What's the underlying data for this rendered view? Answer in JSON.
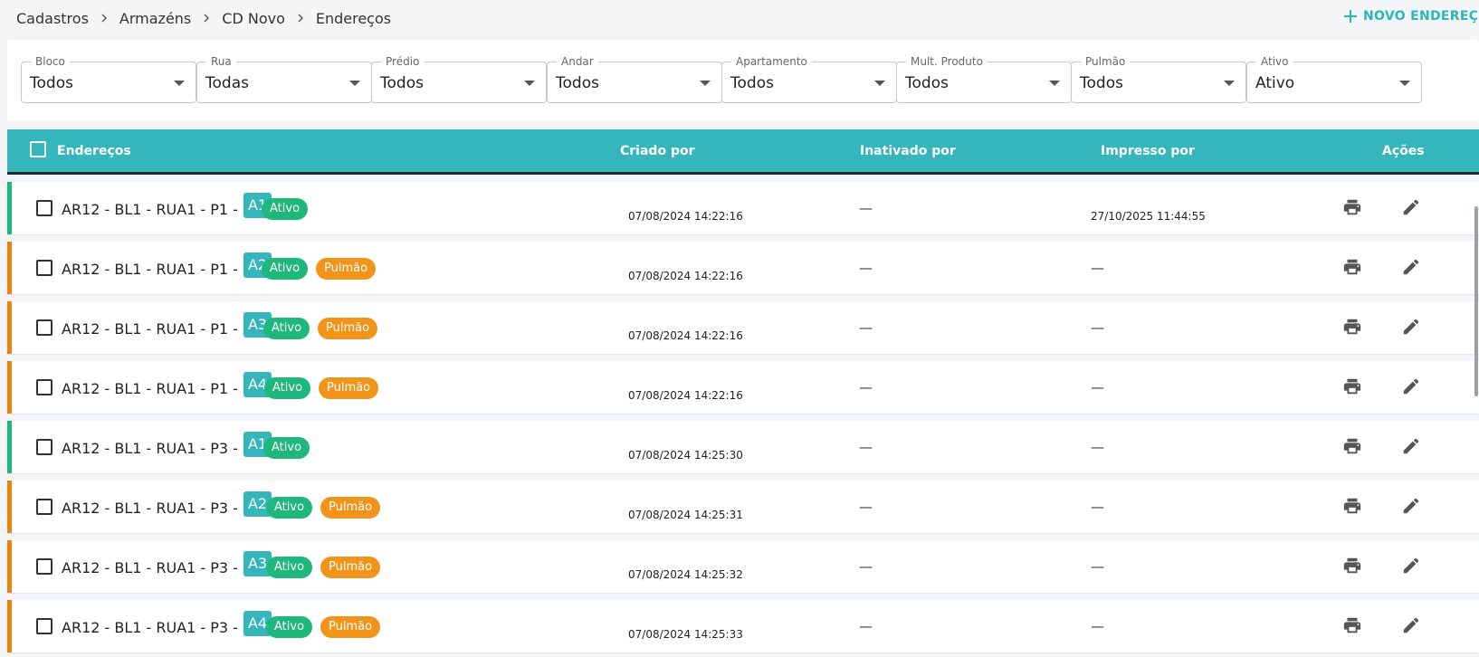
{
  "breadcrumb": [
    "Cadastros",
    "Armazéns",
    "CD Novo",
    "Endereços"
  ],
  "new_button": "NOVO ENDEREÇO",
  "filters": [
    {
      "label": "Bloco",
      "value": "Todos"
    },
    {
      "label": "Rua",
      "value": "Todas"
    },
    {
      "label": "Prédio",
      "value": "Todos"
    },
    {
      "label": "Andar",
      "value": "Todos"
    },
    {
      "label": "Apartamento",
      "value": "Todos"
    },
    {
      "label": "Mult. Produto",
      "value": "Todos"
    },
    {
      "label": "Pulmão",
      "value": "Todos"
    },
    {
      "label": "Ativo",
      "value": "Ativo"
    }
  ],
  "table": {
    "headers": {
      "address": "Endereços",
      "created_by": "Criado por",
      "inactivated_by": "Inativado por",
      "printed_by": "Impresso por",
      "actions": "Ações"
    },
    "rows": [
      {
        "address": "AR12 - BL1 - RUA1 - P1 -",
        "apartment": "A1",
        "badges": [
          "Ativo"
        ],
        "created": "07/08/2024 14:22:16",
        "inactivated": "—",
        "printed": "27/10/2025 11:44:55",
        "status_color": "#1fb87c"
      },
      {
        "address": "AR12 - BL1 - RUA1 - P1 -",
        "apartment": "A2",
        "badges": [
          "Ativo",
          "Pulmão"
        ],
        "created": "07/08/2024 14:22:16",
        "inactivated": "—",
        "printed": "—",
        "status_color": "#f07f12"
      },
      {
        "address": "AR12 - BL1 - RUA1 - P1 -",
        "apartment": "A3",
        "badges": [
          "Ativo",
          "Pulmão"
        ],
        "created": "07/08/2024 14:22:16",
        "inactivated": "—",
        "printed": "—",
        "status_color": "#f07f12"
      },
      {
        "address": "AR12 - BL1 - RUA1 - P1 -",
        "apartment": "A4",
        "badges": [
          "Ativo",
          "Pulmão"
        ],
        "created": "07/08/2024 14:22:16",
        "inactivated": "—",
        "printed": "—",
        "status_color": "#f07f12"
      },
      {
        "address": "AR12 - BL1 - RUA1 - P3 -",
        "apartment": "A1",
        "badges": [
          "Ativo"
        ],
        "created": "07/08/2024 14:25:30",
        "inactivated": "—",
        "printed": "—",
        "status_color": "#1fb87c"
      },
      {
        "address": "AR12 - BL1 - RUA1 - P3 -",
        "apartment": "A2",
        "badges": [
          "Ativo",
          "Pulmão"
        ],
        "created": "07/08/2024 14:25:31",
        "inactivated": "—",
        "printed": "—",
        "status_color": "#f07f12"
      },
      {
        "address": "AR12 - BL1 - RUA1 - P3 -",
        "apartment": "A3",
        "badges": [
          "Ativo",
          "Pulmão"
        ],
        "created": "07/08/2024 14:25:32",
        "inactivated": "—",
        "printed": "—",
        "status_color": "#f07f12"
      },
      {
        "address": "AR12 - BL1 - RUA1 - P3 -",
        "apartment": "A4",
        "badges": [
          "Ativo",
          "Pulmão"
        ],
        "created": "07/08/2024 14:25:33",
        "inactivated": "—",
        "printed": "—",
        "status_color": "#f07f12"
      }
    ]
  },
  "colors": {
    "accent": "#35b6bd",
    "active": "#1fb87c",
    "buffer": "#f2941a"
  },
  "icons": [
    "plus-icon",
    "chevron-right-icon",
    "caret-down-icon",
    "print-icon",
    "edit-icon"
  ]
}
